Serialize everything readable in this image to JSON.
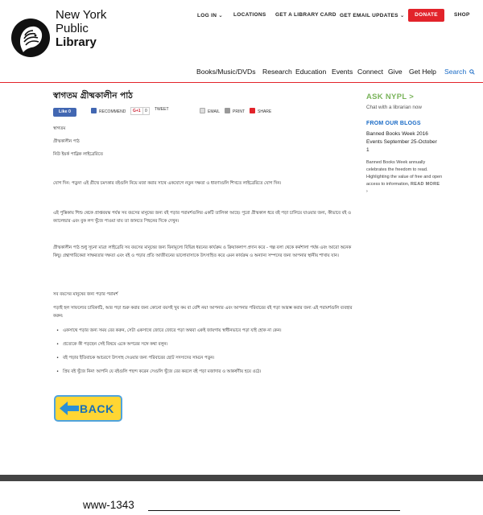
{
  "brand": {
    "line1": "New York",
    "line2": "Public",
    "line3": "Library"
  },
  "topnav": {
    "login": "LOG IN ⌄",
    "locations": "LOCATIONS",
    "card": "GET A LIBRARY CARD",
    "updates": "GET EMAIL UPDATES ⌄",
    "donate": "DONATE",
    "shop": "SHOP"
  },
  "mainnav": {
    "books": "Books/Music/DVDs",
    "research": "Research",
    "education": "Education",
    "events": "Events",
    "connect": "Connect",
    "give": "Give",
    "help": "Get Help",
    "search": "Search"
  },
  "page": {
    "title": "স্বাগতম গ্রীষ্মকালীন পাঠ"
  },
  "share": {
    "like": "Like 0",
    "recommend": "RECOMMEND",
    "gplus": "G+1",
    "gcount": "0",
    "tweet": "TWEET",
    "email": "EMAIL",
    "print": "PRINT",
    "share": "SHARE"
  },
  "content": {
    "p1": "স্বাগতম",
    "p2": "গ্রীষ্মকালীন পাঠ",
    "p3": "নিউ ইয়র্ক পাব্লিক লাইব্রেরিতে",
    "p4": "যোগ দিন: পড়ুন! এই গ্রীষ্মে চমৎকার বইগুলি নিয়ে মজা করার সাথে একযোগে নতুন দক্ষতা ও ধারণাগুলি শিখতে লাইব্রেরিতে যোগ দিন।",
    "p5": "এই পুস্তিকায় শিশু থেকে প্রাপ্তবয়স্ক পর্যন্ত সব বয়সের মানুষের জন্য বই পড়ার পরামর্শগুলির একটি তালিকা আছে। পুরো গ্রীষ্মকাল ধরে বই পড়া চালিয়ে যাওয়ার জন্য, কীভাবে বই ও ক্যালেন্ডার এবং বুক লগ খুঁজে পাওয়া যায় তা জানতে পিছনের দিকে দেখুন।",
    "p6": "গ্রীষ্মকালীন পাঠ শুধু সূচনা মাত্র! লাইব্রেরি সব বয়সের মানুষের জন্য বিনামূল্যে বিভিন্ন ধরনের কার্যক্রম ও ক্রিয়াকলাপ প্রদান করে - গল্প বলা থেকে কর্মশালা পর্যন্ত এবং আরো অনেক কিছু। গ্রন্থাগারিকেরা সাক্ষরতার দক্ষতা এবং বই ও পড়ার প্রতি আজীবনের ভালোবাসাকে উৎসাহিত করে এমন কার্যক্রম ও অন্যান্য সম্পদের জন্য আপনার স্থানীয় শাখায় যান।",
    "p7": "সব বয়সের মানুষের জন্য পড়ার পরামর্শ",
    "p8": "পড়াই হল সাফল্যের চাবিকাঠি, আর পড়া শুরু করার জন্য কোনো বয়সই খুব কম বা বেশি নয়! আপনার এবং আপনার পরিবারের বই পড়া আরম্ভ করার জন্য এই পরামর্শগুলি ব্যবহার করুন:",
    "li1": "একসাথে পড়ার জন্য সময় বের করুন, সেটা একসাথে জোরে জোরে পড়া অথবা একই জায়গায় স্বাধীনভাবে পড়া যাই হোক না কেন।",
    "li2": "প্রত্যেকে কী পড়ছেন সেই বিষয়ে একে অপরের সঙ্গে কথা বলুন।",
    "li3": "বই পড়ার ইতিবাচক আচরণে উৎসাহ দেওয়ার জন্য পরিবারের ছোট সদস্যদের সামনে পড়ুন।",
    "li4": "প্রিয় বই খুঁজে নিন! আপনি যে বইগুলি পছন্দ করেন সেগুলি খুঁজে বের করলে বই পড়া মজাদার ও আকর্ষণীয় হয়ে ওঠে।"
  },
  "back_button": {
    "label": "BACK"
  },
  "sidebar": {
    "ask": "ASK NYPL >",
    "ask_sub": "Chat with a librarian now",
    "blog_heading": "FROM OUR BLOGS",
    "blog_link": "Banned Books Week 2016 Events September 25-October 1",
    "blog_desc": "Banned Books Week annually celebrates the freedom to read. Highlighting the value of free and open access to information,",
    "read_more": "READ MORE ›"
  },
  "footer": {
    "code": "www-1343"
  },
  "colors": {
    "accent_red": "#e2232a",
    "link_blue": "#1a6bc6",
    "ask_green": "#79b35a",
    "back_yellow": "#ffd633"
  }
}
